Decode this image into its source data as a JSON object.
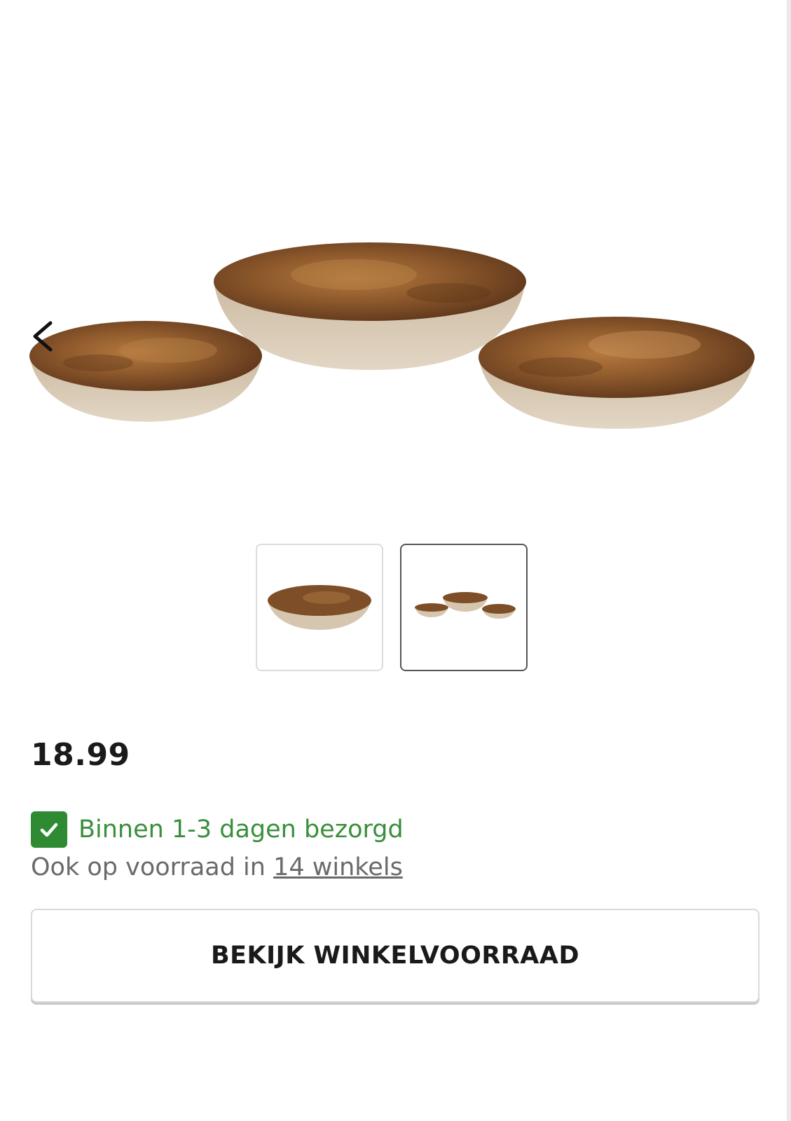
{
  "product": {
    "price": "18.99",
    "delivery": {
      "text": "Binnen 1-3 dagen bezorgd"
    },
    "stock": {
      "prefix": "Ook op voorraad in ",
      "link": "14 winkels"
    },
    "button_label": "BEKIJK WINKELVOORRAAD"
  },
  "gallery": {
    "thumbnail_count": 2,
    "active_thumbnail": 2,
    "nav_icon": "chevron-left-icon"
  },
  "colors": {
    "accent_green": "#2e8b34",
    "delivery_text": "#3a8f3c",
    "bowl_exterior": "#d8c9b4",
    "bowl_interior": "#8a5a2e"
  }
}
